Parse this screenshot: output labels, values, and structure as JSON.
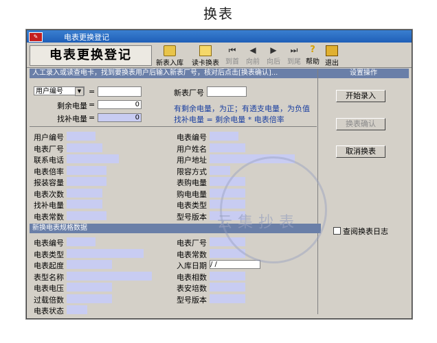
{
  "page": {
    "title": "换表"
  },
  "window": {
    "title": "电表更换登记",
    "app_icon": "app-icon"
  },
  "toolbar": {
    "banner": "电表更换登记",
    "buttons": [
      {
        "label": "新表入库",
        "icon": "box-icon",
        "enabled": true
      },
      {
        "label": "读卡换表",
        "icon": "card-icon",
        "enabled": true
      },
      {
        "label": "到首",
        "icon": "first-icon",
        "enabled": false
      },
      {
        "label": "向前",
        "icon": "prev-icon",
        "enabled": false
      },
      {
        "label": "向后",
        "icon": "next-icon",
        "enabled": false
      },
      {
        "label": "到尾",
        "icon": "last-icon",
        "enabled": false
      },
      {
        "label": "帮助",
        "icon": "help-icon",
        "enabled": true
      },
      {
        "label": "退出",
        "icon": "exit-icon",
        "enabled": true
      }
    ]
  },
  "instruction": "人工录入或读查电卡，找到要换表用户后输入新表厂号，核对后点击[换表确认]...",
  "right_panel": {
    "title": "设置操作",
    "start_button": "开始录入",
    "confirm_button": "换表确认",
    "cancel_button": "取消换表",
    "checkbox_label": "查阅换表日志"
  },
  "query": {
    "selector": "用户编号",
    "eq": "=",
    "remaining_label": "剩余电量",
    "remaining_value": "0",
    "makeup_label": "找补电量",
    "makeup_value": "0",
    "new_meter_label": "新表厂号",
    "note1": "有剩余电量，为正；有透支电量，为负值",
    "note2": "找补电量 = 剩余电量 * 电表倍率"
  },
  "old_meter": {
    "left": [
      "用户编号",
      "电表厂号",
      "联系电话",
      "电表倍率",
      "报装容量",
      "电表次数",
      "找补电量",
      "电表常数"
    ],
    "right": [
      "电表编号",
      "用户姓名",
      "用户地址",
      "限容方式",
      "表购电量",
      "购电电量",
      "电表类型",
      "型号版本"
    ]
  },
  "new_meter": {
    "section_title": "新换电表规格数据",
    "left": [
      "电表编号",
      "电表类型",
      "电表起度",
      "表型名称",
      "电表电压",
      "过载倍数",
      "电表状态"
    ],
    "right": [
      "电表厂号",
      "电表常数",
      "入库日期",
      "电表相数",
      "表安培数",
      "型号版本"
    ],
    "date_value": " /  / "
  },
  "watermark": {
    "text": "云集抄表"
  },
  "colors": {
    "titlebar": "#1f5fb8",
    "field": "#c8ccf2",
    "note": "#1a3fa0",
    "section": "#6a7fa8"
  }
}
